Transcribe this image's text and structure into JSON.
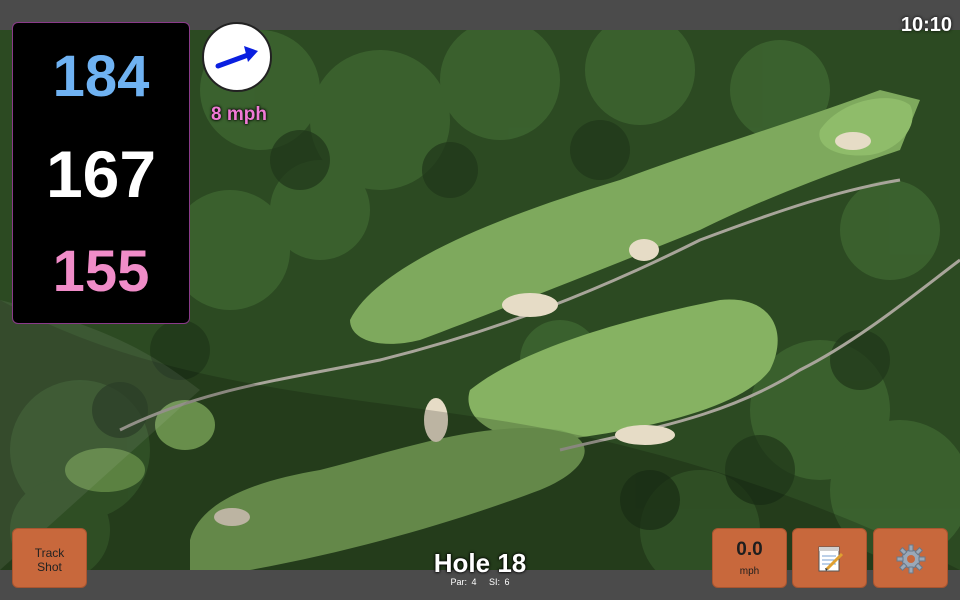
{
  "status": {
    "time": "10:10"
  },
  "distances": {
    "back": "184",
    "middle": "167",
    "front": "155"
  },
  "wind": {
    "speed_label": "8 mph",
    "direction": "east-northeast"
  },
  "buttons": {
    "track_shot": [
      "Track",
      "Shot"
    ],
    "wind_value": "0.0",
    "wind_unit": "mph",
    "notes_icon": "notepad-icon",
    "settings_icon": "gear-icon"
  },
  "hole": {
    "title": "Hole 18",
    "par": "Par: 4",
    "si": "SI: 6"
  },
  "colors": {
    "back_distance": "#6fb2f2",
    "middle_distance": "#ffffff",
    "front_distance": "#f08cc8",
    "wind_text": "#f07ad6",
    "button": "#c8683c"
  }
}
